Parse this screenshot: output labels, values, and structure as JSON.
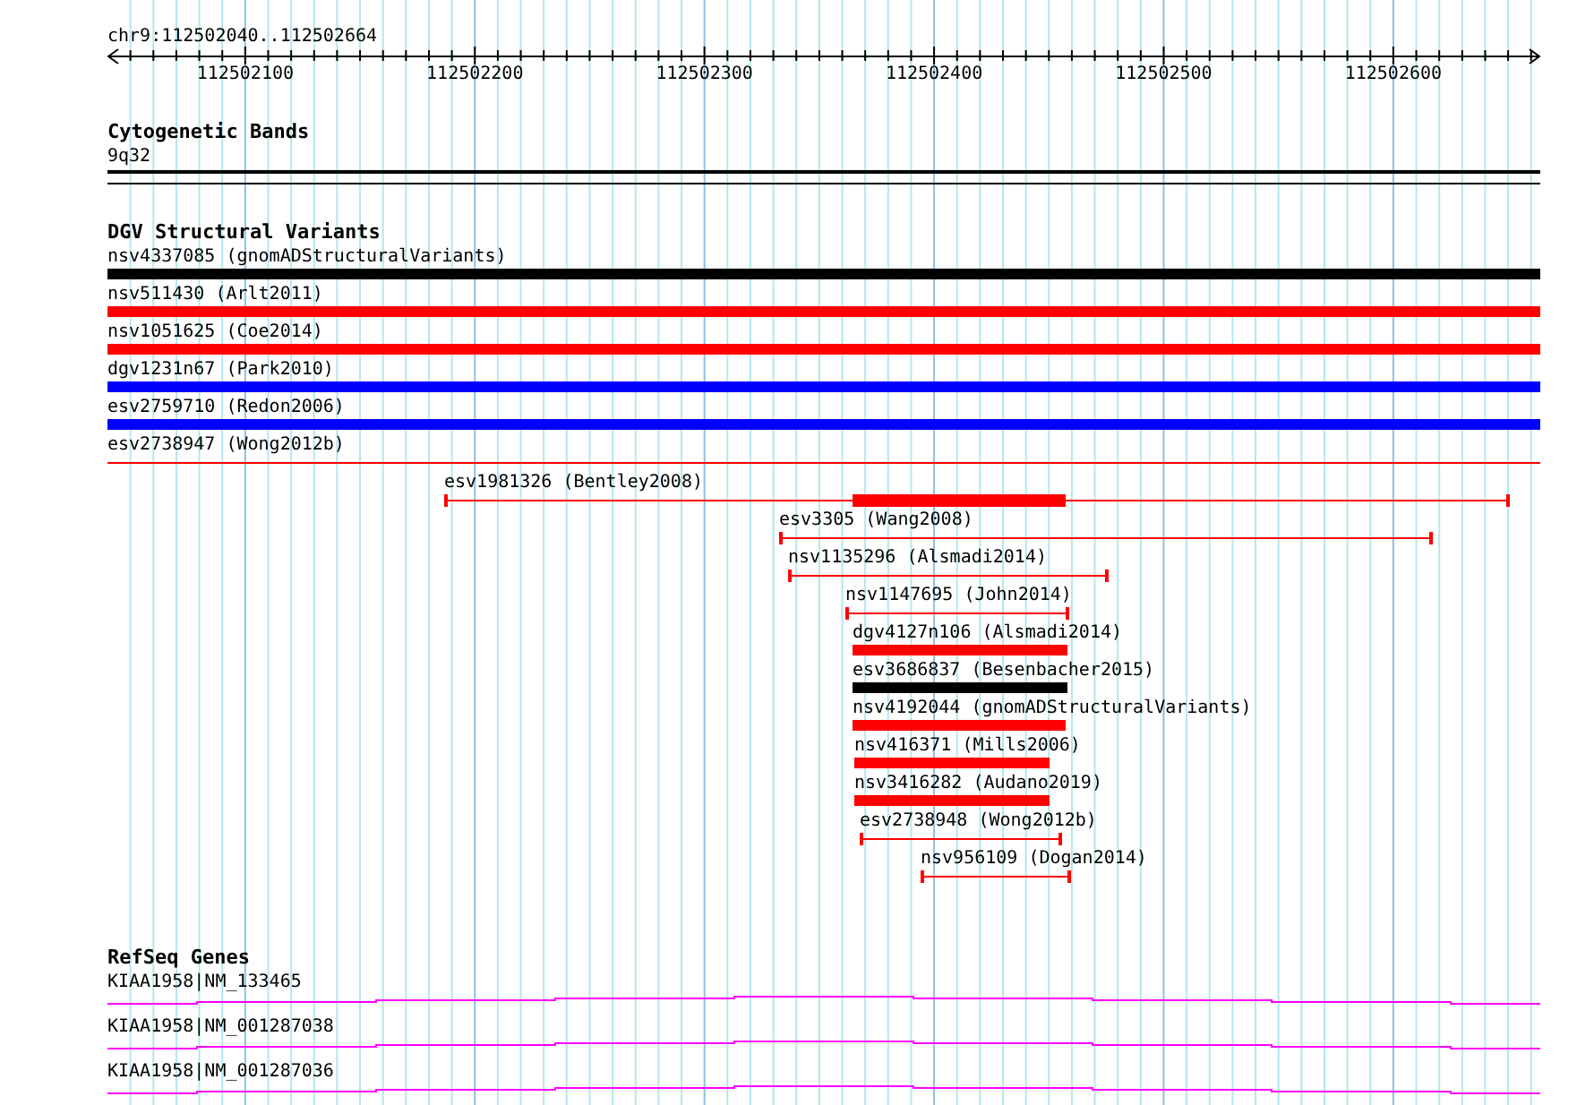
{
  "ruler": {
    "title": "chr9:112502040..112502664",
    "tick_labels": [
      "112502100",
      "112502200",
      "112502300",
      "112502400",
      "112502500",
      "112502600"
    ]
  },
  "tracks": [
    {
      "title": "Cytogenetic Bands",
      "features": [
        {
          "label": "9q32",
          "kind": "band",
          "color": "#000000"
        }
      ]
    },
    {
      "title": "DGV Structural Variants",
      "features": [
        {
          "label": "nsv4337085 (gnomADStructuralVariants)",
          "kind": "bar",
          "color": "#000000"
        },
        {
          "label": "nsv511430 (Arlt2011)",
          "kind": "bar",
          "color": "#ff0000"
        },
        {
          "label": "nsv1051625 (Coe2014)",
          "kind": "bar",
          "color": "#ff0000"
        },
        {
          "label": "dgv1231n67 (Park2010)",
          "kind": "bar",
          "color": "#0000ff"
        },
        {
          "label": "esv2759710 (Redon2006)",
          "kind": "bar",
          "color": "#0000ff"
        },
        {
          "label": "esv2738947 (Wong2012b)",
          "kind": "line",
          "color": "#ff0000"
        },
        {
          "label": "esv1981326 (Bentley2008)",
          "kind": "span_thick",
          "color": "#ff0000"
        },
        {
          "label": "esv3305 (Wang2008)",
          "kind": "span",
          "color": "#ff0000"
        },
        {
          "label": "nsv1135296 (Alsmadi2014)",
          "kind": "span",
          "color": "#ff0000"
        },
        {
          "label": "nsv1147695 (John2014)",
          "kind": "span",
          "color": "#ff0000"
        },
        {
          "label": "dgv4127n106 (Alsmadi2014)",
          "kind": "bar",
          "color": "#ff0000"
        },
        {
          "label": "esv3686837 (Besenbacher2015)",
          "kind": "bar",
          "color": "#000000"
        },
        {
          "label": "nsv4192044 (gnomADStructuralVariants)",
          "kind": "bar",
          "color": "#ff0000"
        },
        {
          "label": "nsv416371 (Mills2006)",
          "kind": "bar",
          "color": "#ff0000"
        },
        {
          "label": "nsv3416282 (Audano2019)",
          "kind": "bar",
          "color": "#ff0000"
        },
        {
          "label": "esv2738948 (Wong2012b)",
          "kind": "span",
          "color": "#ff0000"
        },
        {
          "label": "nsv956109 (Dogan2014)",
          "kind": "span",
          "color": "#ff0000"
        }
      ]
    },
    {
      "title": "RefSeq Genes",
      "features": [
        {
          "label": "KIAA1958|NM_133465",
          "kind": "gene",
          "color": "#ff00ff"
        },
        {
          "label": "KIAA1958|NM_001287038",
          "kind": "gene",
          "color": "#ff00ff"
        },
        {
          "label": "KIAA1958|NM_001287036",
          "kind": "gene",
          "color": "#ff00ff"
        }
      ]
    }
  ]
}
